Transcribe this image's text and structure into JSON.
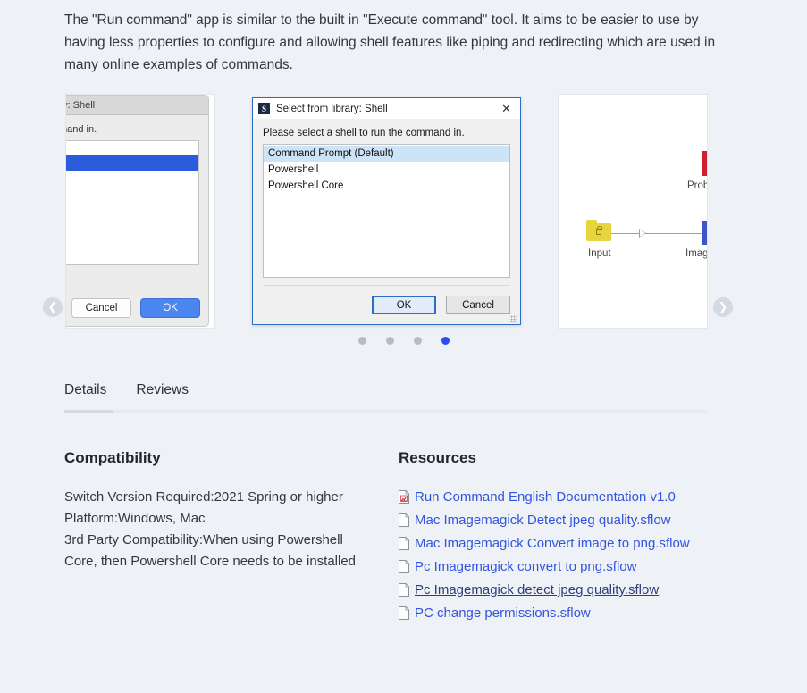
{
  "description": "The \"Run command\" app is similar to the built in \"Execute command\" tool. It aims to be easier to use by having less properties to configure and allowing shell features like piping and redirecting which are used in many online examples of commands.",
  "carousel": {
    "prev_icon": "chevron-left-icon",
    "next_icon": "chevron-right-icon",
    "prev_glyph": "❮",
    "next_glyph": "❯",
    "dot_count": 4,
    "active_dot_index": 3,
    "slides": [
      {
        "type": "mac-dialog",
        "title": "ibrary: Shell",
        "prompt": "e command in."
      },
      {
        "type": "windows-dialog",
        "app_icon_letter": "S",
        "title": "Select from library: Shell",
        "close_glyph": "✕",
        "prompt": "Please select a shell to run the command in.",
        "list_items": [
          "Command Prompt (Default)",
          "Powershell",
          "Powershell Core"
        ],
        "selected_index": 0,
        "ok_label": "OK",
        "cancel_label": "Cancel"
      },
      {
        "type": "workflow",
        "nodes": [
          {
            "label": "Input",
            "icon": "yellow-folder-lock-icon"
          },
          {
            "label": "Image",
            "icon": "blue-app-icon"
          },
          {
            "label": "Proble",
            "icon": "red-document-icon"
          }
        ]
      }
    ]
  },
  "mac_dialog": {
    "cancel_label": "Cancel",
    "ok_label": "OK"
  },
  "tabs": {
    "items": [
      {
        "label": "Details",
        "active": true
      },
      {
        "label": "Reviews",
        "active": false
      }
    ]
  },
  "compatibility": {
    "heading": "Compatibility",
    "lines": [
      "Switch Version Required:2021 Spring or higher",
      "Platform:Windows, Mac",
      "3rd Party Compatibility:When using Powershell Core, then Powershell Core needs to be installed"
    ]
  },
  "resources": {
    "heading": "Resources",
    "items": [
      {
        "label": "Run Command English Documentation v1.0",
        "icon": "pdf-document-icon",
        "hovered": false
      },
      {
        "label": "Mac Imagemagick Detect jpeg quality.sflow",
        "icon": "file-document-icon",
        "hovered": false
      },
      {
        "label": "Mac Imagemagick Convert image to png.sflow",
        "icon": "file-document-icon",
        "hovered": false
      },
      {
        "label": "Pc Imagemagick convert to png.sflow",
        "icon": "file-document-icon",
        "hovered": false
      },
      {
        "label": "Pc Imagemagick detect jpeg quality.sflow",
        "icon": "file-document-icon",
        "hovered": true
      },
      {
        "label": "PC change permissions.sflow",
        "icon": "file-document-icon",
        "hovered": false
      }
    ]
  },
  "colors": {
    "page_background": "#eef1f6",
    "link": "#3355dd",
    "link_hover": "#2b3f7a",
    "dot_active": "#2b4cf0",
    "dot_inactive": "#b6bcc6",
    "windows_accent": "#2b6fc4",
    "mac_accent": "#4a85f0"
  }
}
